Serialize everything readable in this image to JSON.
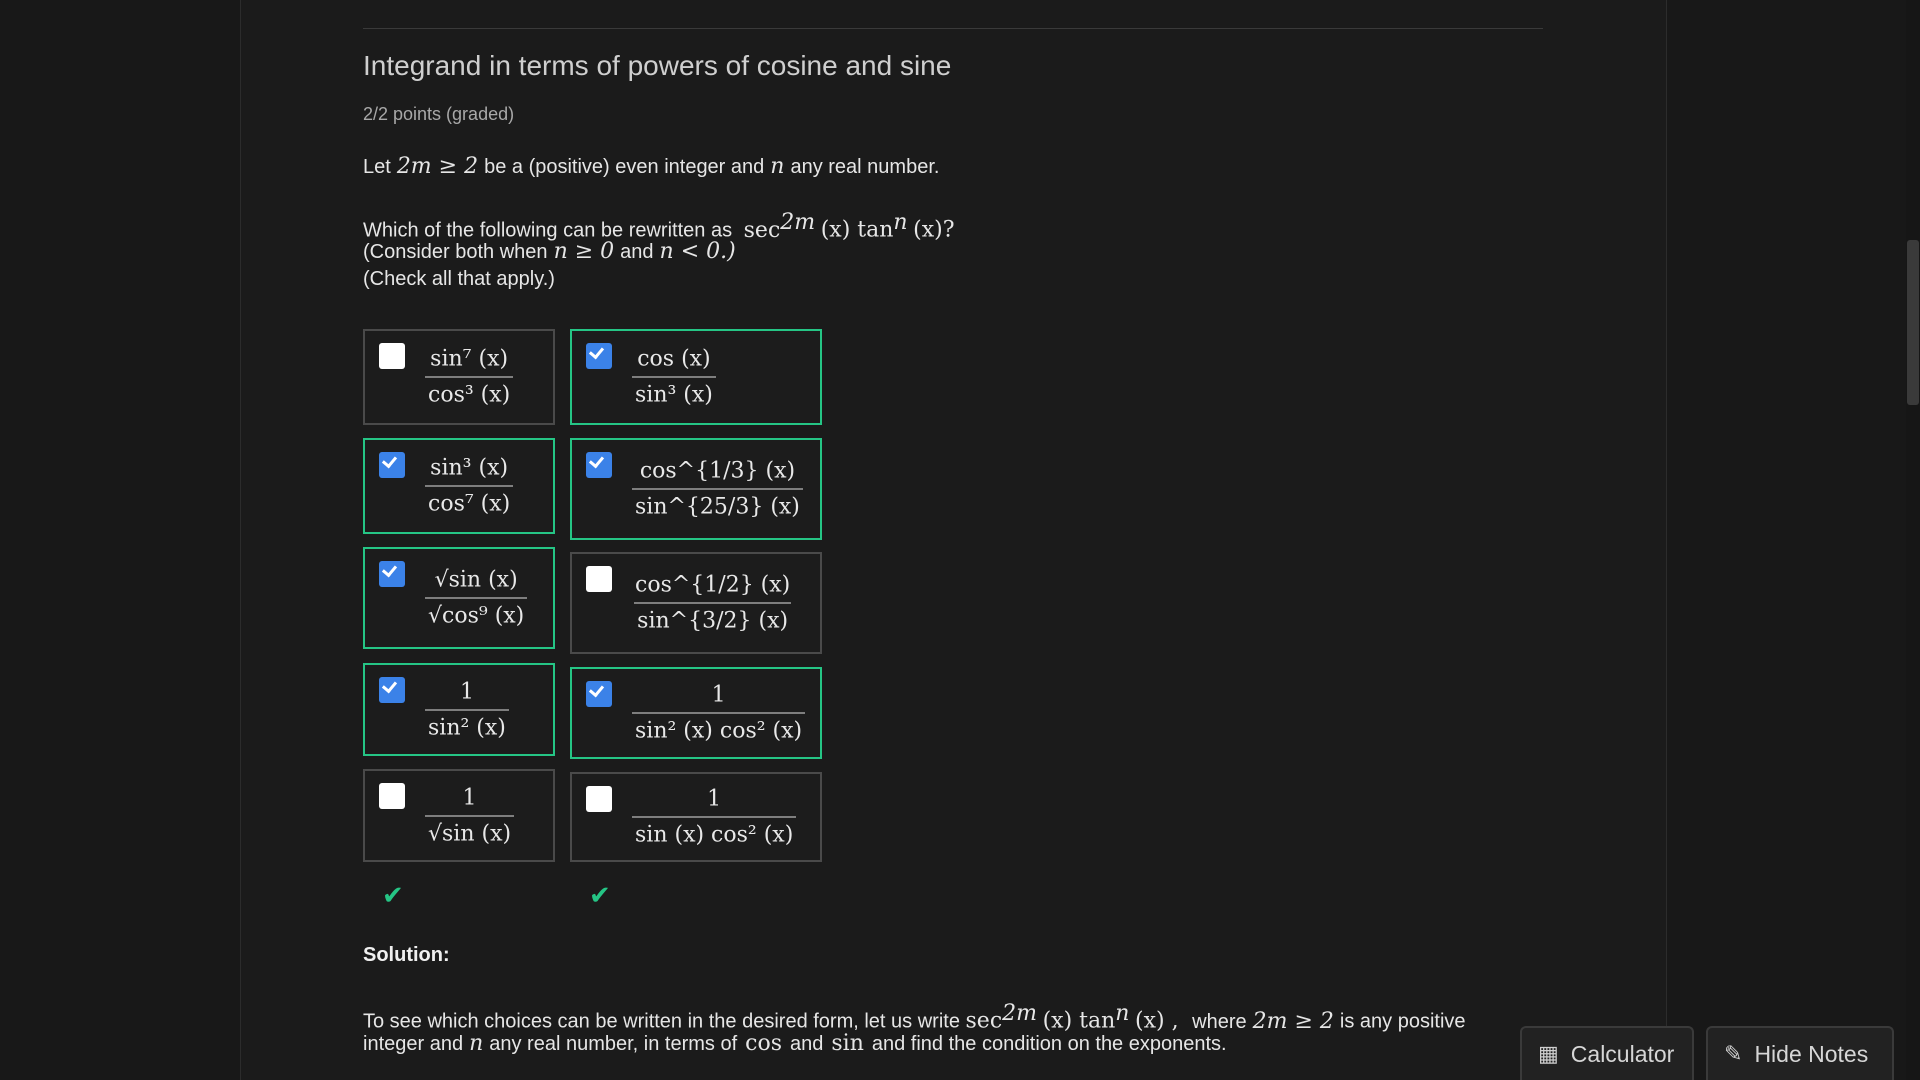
{
  "problem": {
    "title": "Integrand in terms of powers of cosine and sine",
    "points": "2/2 points (graded)",
    "intro": {
      "a": "Let",
      "b": "2m ≥ 2",
      "c": "be a (positive) even integer and",
      "d": "n",
      "e": "any real number."
    },
    "question": {
      "a": "Which of the following can be rewritten as",
      "b": "sec",
      "b_sup": "2m",
      "c": "(x) tan",
      "c_sup": "n",
      "d": "(x)?",
      "e": "(Consider both when",
      "f": "n ≥ 0",
      "g": "and",
      "h": "n < 0.)",
      "i": "(Check all that apply.)"
    }
  },
  "choices": [
    {
      "num": "sin⁷ (x)",
      "den": "cos³ (x)",
      "checked": false,
      "correct": false
    },
    {
      "num": "cos (x)",
      "den": "sin³ (x)",
      "checked": true,
      "correct": true
    },
    {
      "num": "sin³ (x)",
      "den": "cos⁷ (x)",
      "checked": true,
      "correct": true
    },
    {
      "num": "cos^{1/3} (x)",
      "den": "sin^{25/3} (x)",
      "checked": true,
      "correct": true
    },
    {
      "num": "√sin (x)",
      "den": "√cos⁹ (x)",
      "checked": true,
      "correct": true
    },
    {
      "num": "cos^{1/2} (x)",
      "den": "sin^{3/2} (x)",
      "checked": false,
      "correct": false
    },
    {
      "num": "1",
      "den": "sin² (x)",
      "checked": true,
      "correct": true
    },
    {
      "num": "1",
      "den": "sin² (x) cos² (x)",
      "checked": true,
      "correct": true
    },
    {
      "num": "1",
      "den": "√sin (x)",
      "checked": false,
      "correct": false
    },
    {
      "num": "1",
      "den": "sin (x) cos² (x)",
      "checked": false,
      "correct": false
    }
  ],
  "status_icons": [
    "check-icon",
    "check-icon"
  ],
  "solution": {
    "heading": "Solution:",
    "line1": {
      "a": "To see which choices can be written in the desired form, let us write",
      "b": "sec",
      "b_sup": "2m",
      "c": "(x) tan",
      "c_sup": "n",
      "d": "(x) ,",
      "e": "where",
      "f": "2m ≥ 2",
      "g": "is any positive"
    },
    "line2": {
      "a": "integer and",
      "b": "n",
      "c": "any real number, in terms of",
      "d": "cos",
      "e": "and",
      "f": "sin",
      "g": "and find the condition on the exponents."
    }
  },
  "footer": {
    "calculator": "Calculator",
    "hide_notes": "Hide Notes"
  },
  "colors": {
    "correct_border": "#25c585",
    "checkbox_checked": "#3b82e8",
    "background": "#1b1b1b"
  }
}
